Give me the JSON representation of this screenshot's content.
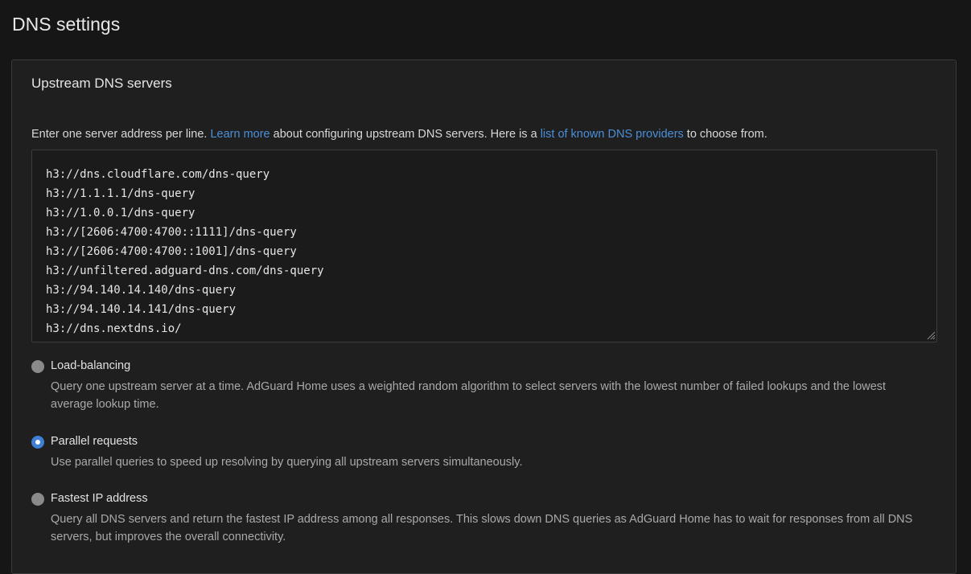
{
  "page": {
    "title": "DNS settings"
  },
  "upstream": {
    "title": "Upstream DNS servers",
    "hint_prefix": "Enter one server address per line. ",
    "learn_more": "Learn more",
    "hint_middle": " about configuring upstream DNS servers. Here is a ",
    "providers_link": "list of known DNS providers",
    "hint_suffix": " to choose from.",
    "servers": "h3://dns.cloudflare.com/dns-query\nh3://1.1.1.1/dns-query\nh3://1.0.0.1/dns-query\nh3://[2606:4700:4700::1111]/dns-query\nh3://[2606:4700:4700::1001]/dns-query\nh3://unfiltered.adguard-dns.com/dns-query\nh3://94.140.14.140/dns-query\nh3://94.140.14.141/dns-query\nh3://dns.nextdns.io/"
  },
  "modes": [
    {
      "label": "Load-balancing",
      "description": "Query one upstream server at a time. AdGuard Home uses a weighted random algorithm to select servers with the lowest number of failed lookups and the lowest average lookup time.",
      "selected": false
    },
    {
      "label": "Parallel requests",
      "description": "Use parallel queries to speed up resolving by querying all upstream servers simultaneously.",
      "selected": true
    },
    {
      "label": "Fastest IP address",
      "description": "Query all DNS servers and return the fastest IP address among all responses. This slows down DNS queries as AdGuard Home has to wait for responses from all DNS servers, but improves the overall connectivity.",
      "selected": false
    }
  ],
  "colors": {
    "link": "#4b8fd9",
    "radio_selected": "#3f7fd6",
    "radio_unselected": "#8a8a8a"
  }
}
